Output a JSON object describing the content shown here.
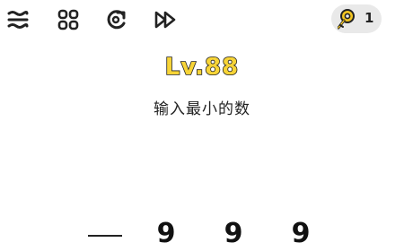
{
  "toolbar": {
    "icons": [
      "menu-icon",
      "grid-icon",
      "restart-icon",
      "skip-icon"
    ]
  },
  "keys": {
    "count": "1",
    "icon": "key-icon"
  },
  "level": {
    "title": "Lv.88"
  },
  "question": {
    "text": "输入最小的数"
  },
  "answer": {
    "digits": [
      "9",
      "9",
      "9"
    ]
  },
  "colors": {
    "level_fill": "#f7d437",
    "badge_bg": "#e9e9e9",
    "key_fill": "#f3c623"
  }
}
